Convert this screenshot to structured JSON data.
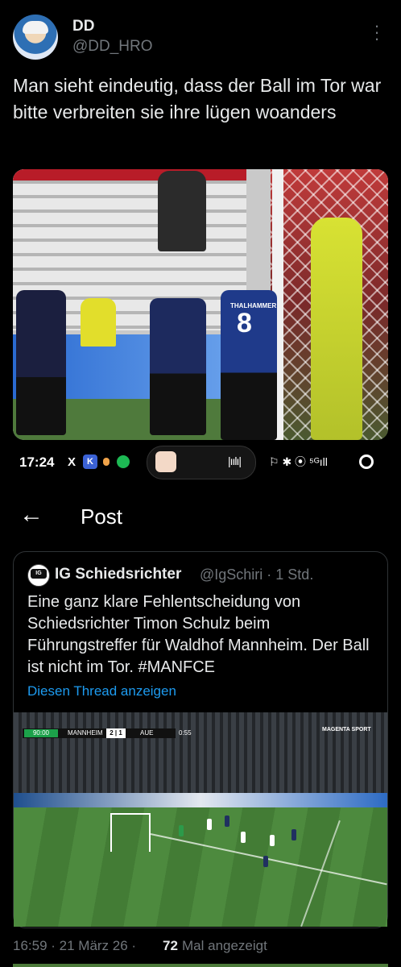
{
  "tweet": {
    "author_name": "DD",
    "author_handle": "@DD_HRO",
    "more_icon": "more-icon",
    "text": "Man sieht eindeutig, dass der Ball im Tor war bitte verbreiten sie ihre lügen woanders",
    "photo": {
      "player_number": "8",
      "player_name": "THALHAMMER"
    }
  },
  "status_bar": {
    "time": "17:24",
    "x_icon": "X",
    "k_icon": "K",
    "right_icons": "⚐ ✱ ⦿ ⁵ᴳıll",
    "wave_icon": "|ıılı|"
  },
  "header": {
    "back_icon": "←",
    "title": "Post"
  },
  "quote": {
    "avatar_text": "IG",
    "author_name": "IG Schiedsrichter",
    "meta": "@IgSchiri · 1 Std.",
    "text": "Eine ganz klare Fehlentscheidung von Schiedsrichter Timon Schulz beim Führungstreffer für Waldhof Mannheim. Der Ball ist nicht im Tor. #MANFCE",
    "thread_link": "Diesen Thread anzeigen",
    "scoreboard": {
      "minute": "90:00",
      "team1": "MANNHEIM",
      "score": "2 | 1",
      "team2": "AUE",
      "clock": "0:55",
      "broadcaster": "MAGENTA SPORT"
    }
  },
  "footer": {
    "timestamp": "16:59 · 21 März 26 ·",
    "views": "72",
    "views_label": "Mal angezeigt"
  },
  "colors": {
    "background": "#000000",
    "text": "#e7e9ea",
    "muted": "#71767b",
    "link": "#1d9bf0",
    "border": "#2f3336"
  }
}
